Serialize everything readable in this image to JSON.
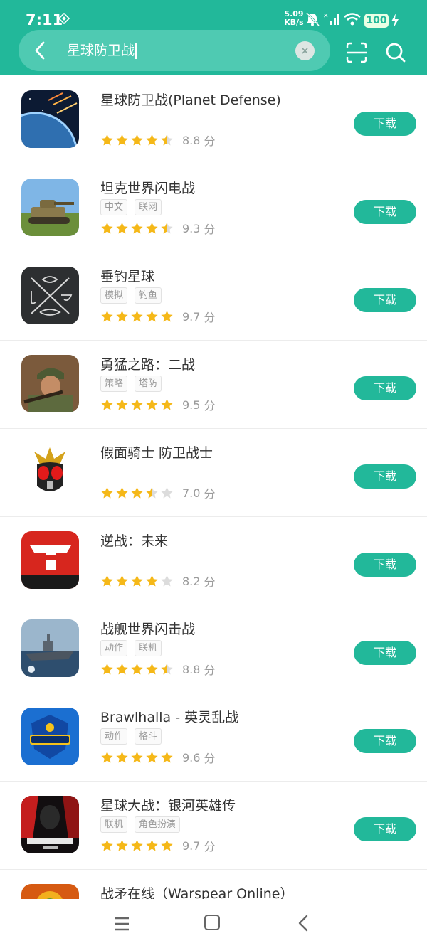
{
  "status": {
    "time": "7:11",
    "speed_value": "5.09",
    "speed_unit": "KB/s",
    "battery": "100"
  },
  "search": {
    "query": "星球防卫战"
  },
  "colors": {
    "accent": "#22b89a",
    "star": "#f5b818",
    "star_empty": "#dcdcdc"
  },
  "download_label": "下载",
  "score_unit": "分",
  "apps": [
    {
      "name": "星球防卫战(Planet Defense)",
      "tags": [],
      "rating": 4.5,
      "score": "8.8",
      "icon": "planet-defense-icon"
    },
    {
      "name": "坦克世界闪电战",
      "tags": [
        "中文",
        "联网"
      ],
      "rating": 4.5,
      "score": "9.3",
      "icon": "tank-icon"
    },
    {
      "name": "垂钓星球",
      "tags": [
        "模拟",
        "钓鱼"
      ],
      "rating": 5,
      "score": "9.7",
      "icon": "fishing-icon"
    },
    {
      "name": "勇猛之路：二战",
      "tags": [
        "策略",
        "塔防"
      ],
      "rating": 5,
      "score": "9.5",
      "icon": "soldier-icon"
    },
    {
      "name": "假面骑士 防卫战士",
      "tags": [],
      "rating": 3.5,
      "score": "7.0",
      "icon": "masked-rider-icon"
    },
    {
      "name": "逆战：未来",
      "tags": [],
      "rating": 4,
      "score": "8.2",
      "icon": "nizhan-icon"
    },
    {
      "name": "战舰世界闪击战",
      "tags": [
        "动作",
        "联机"
      ],
      "rating": 4.5,
      "score": "8.8",
      "icon": "warship-icon"
    },
    {
      "name": "Brawlhalla - 英灵乱战",
      "tags": [
        "动作",
        "格斗"
      ],
      "rating": 5,
      "score": "9.6",
      "icon": "brawlhalla-icon"
    },
    {
      "name": "星球大战：银河英雄传",
      "tags": [
        "联机",
        "角色扮演"
      ],
      "rating": 5,
      "score": "9.7",
      "icon": "star-wars-icon"
    },
    {
      "name": "战矛在线（Warspear Online）",
      "tags": [],
      "rating": 0,
      "score": "",
      "icon": "warspear-icon"
    }
  ],
  "nav": {
    "menu_icon": "menu-icon",
    "home_icon": "home-icon",
    "back_icon": "back-icon"
  }
}
